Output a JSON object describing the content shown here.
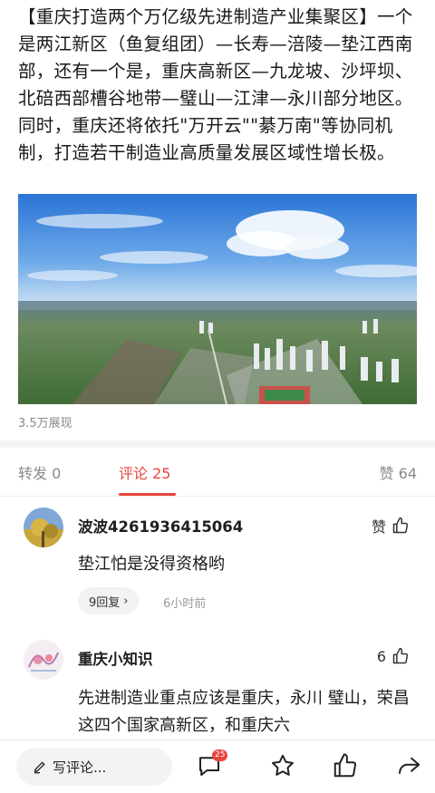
{
  "post": {
    "text": "【重庆打造两个万亿级先进制造产业集聚区】一个是两江新区（鱼复组团）—长寿—涪陵—垫江西南部，还有一个是，重庆高新区—九龙坡、沙坪坝、北碚西部槽谷地带—璧山—江津—永川部分地区。同时，重庆还将依托\"万开云\"\"綦万南\"等协同机制，打造若干制造业高质量发展区域性增长极。",
    "views": "3.5万展现"
  },
  "tabs": {
    "repost": "转发 0",
    "comments": "评论 25",
    "likes": "赞 64"
  },
  "comments": [
    {
      "name": "波波4261936415064",
      "like_label": "赞",
      "text": "垫江怕是没得资格哟",
      "replies": "9回复",
      "time": "6小时前"
    },
    {
      "name": "重庆小知识",
      "like_label": "6",
      "text": "先进制造业重点应该是重庆，永川 璧山，荣昌这四个国家高新区，和重庆六"
    }
  ],
  "bottom_bar": {
    "write_placeholder": "写评论...",
    "comment_badge": "25"
  },
  "colors": {
    "accent": "#e8433d",
    "muted": "#8a8a8a"
  }
}
